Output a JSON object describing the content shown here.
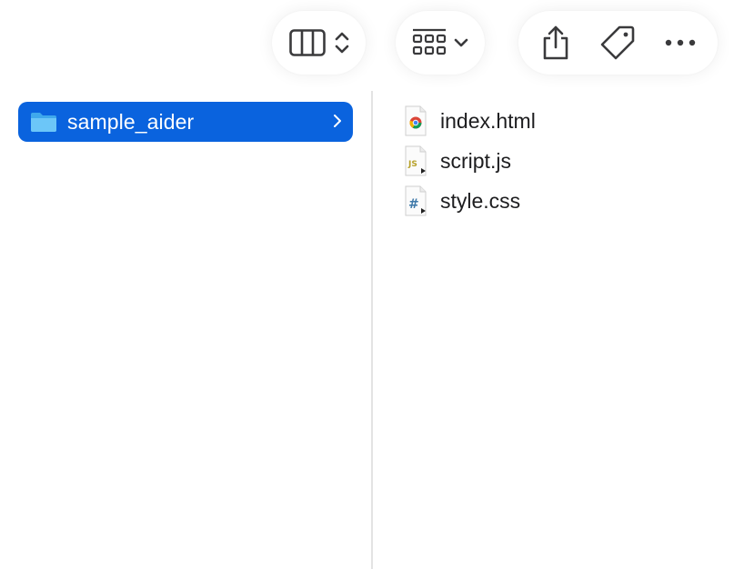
{
  "toolbar": {
    "view_group": {
      "icon": "columns-view-icon",
      "chevron": "up-down-chevron-icon"
    },
    "group_by": {
      "icon": "icon-grid-view-icon",
      "chevron": "chevron-down-icon"
    },
    "actions": [
      {
        "name": "share",
        "icon": "share-icon"
      },
      {
        "name": "tag",
        "icon": "tag-icon"
      },
      {
        "name": "more",
        "icon": "ellipsis-icon"
      }
    ]
  },
  "left_column": {
    "selected_folder": {
      "name": "sample_aider",
      "icon": "folder-icon"
    }
  },
  "right_column": {
    "files": [
      {
        "name": "index.html",
        "icon": "chrome-html-file-icon"
      },
      {
        "name": "script.js",
        "icon": "js-file-icon"
      },
      {
        "name": "style.css",
        "icon": "css-file-icon"
      }
    ]
  },
  "colors": {
    "selection": "#0a63de",
    "folder": "#5bbcf5",
    "js_badge": "#b7a12a",
    "css_badge": "#3d78a8"
  }
}
